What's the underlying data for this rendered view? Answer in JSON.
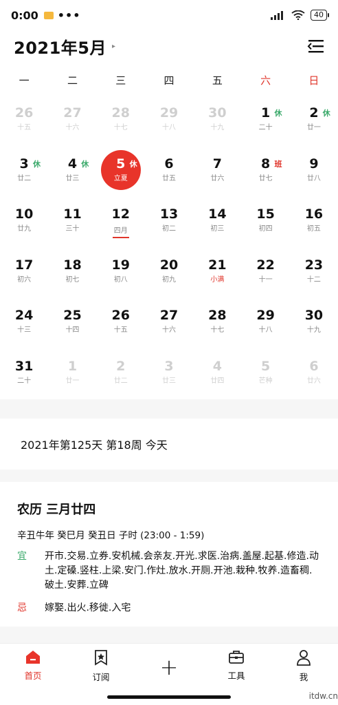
{
  "status": {
    "time": "0:00",
    "dots": "•••",
    "signal": "4G",
    "battery": "40"
  },
  "header": {
    "title": "2021年5月",
    "caret": "▸"
  },
  "weekdays": [
    "一",
    "二",
    "三",
    "四",
    "五",
    "六",
    "日"
  ],
  "days": [
    {
      "num": "26",
      "lunar": "十五",
      "faded": true
    },
    {
      "num": "27",
      "lunar": "十六",
      "faded": true
    },
    {
      "num": "28",
      "lunar": "十七",
      "faded": true
    },
    {
      "num": "29",
      "lunar": "十八",
      "faded": true
    },
    {
      "num": "30",
      "lunar": "十九",
      "faded": true
    },
    {
      "num": "1",
      "lunar": "二十",
      "tag": "休",
      "tagType": "rest"
    },
    {
      "num": "2",
      "lunar": "廿一",
      "tag": "休",
      "tagType": "rest"
    },
    {
      "num": "3",
      "lunar": "廿二",
      "tag": "休",
      "tagType": "rest"
    },
    {
      "num": "4",
      "lunar": "廿三",
      "tag": "休",
      "tagType": "rest"
    },
    {
      "num": "5",
      "lunar": "立夏",
      "tag": "休",
      "tagType": "rest",
      "today": true
    },
    {
      "num": "6",
      "lunar": "廿五"
    },
    {
      "num": "7",
      "lunar": "廿六"
    },
    {
      "num": "8",
      "lunar": "廿七",
      "tag": "班",
      "tagType": "work"
    },
    {
      "num": "9",
      "lunar": "廿八"
    },
    {
      "num": "10",
      "lunar": "廿九"
    },
    {
      "num": "11",
      "lunar": "三十"
    },
    {
      "num": "12",
      "lunar": "四月",
      "underline": true
    },
    {
      "num": "13",
      "lunar": "初二"
    },
    {
      "num": "14",
      "lunar": "初三"
    },
    {
      "num": "15",
      "lunar": "初四"
    },
    {
      "num": "16",
      "lunar": "初五"
    },
    {
      "num": "17",
      "lunar": "初六"
    },
    {
      "num": "18",
      "lunar": "初七"
    },
    {
      "num": "19",
      "lunar": "初八"
    },
    {
      "num": "20",
      "lunar": "初九"
    },
    {
      "num": "21",
      "lunar": "小满",
      "red": true
    },
    {
      "num": "22",
      "lunar": "十一"
    },
    {
      "num": "23",
      "lunar": "十二"
    },
    {
      "num": "24",
      "lunar": "十三"
    },
    {
      "num": "25",
      "lunar": "十四"
    },
    {
      "num": "26",
      "lunar": "十五"
    },
    {
      "num": "27",
      "lunar": "十六"
    },
    {
      "num": "28",
      "lunar": "十七"
    },
    {
      "num": "29",
      "lunar": "十八"
    },
    {
      "num": "30",
      "lunar": "十九"
    },
    {
      "num": "31",
      "lunar": "二十"
    },
    {
      "num": "1",
      "lunar": "廿一",
      "faded": true
    },
    {
      "num": "2",
      "lunar": "廿二",
      "faded": true
    },
    {
      "num": "3",
      "lunar": "廿三",
      "faded": true
    },
    {
      "num": "4",
      "lunar": "廿四",
      "faded": true
    },
    {
      "num": "5",
      "lunar": "芒种",
      "faded": true
    },
    {
      "num": "6",
      "lunar": "廿六",
      "faded": true
    }
  ],
  "info": {
    "text": "2021年第125天 第18周 今天"
  },
  "almanac": {
    "title": "农历 三月廿四",
    "ganzhi": "辛丑牛年 癸巳月 癸丑日 子时 (23:00 - 1:59)",
    "yi_label": "宜",
    "yi_text": "开市.交易.立券.安机械.会亲友.开光.求医.治病.盖屋.起基.修造.动土.定磉.竖柱.上梁.安门.作灶.放水.开厕.开池.栽种.牧养.造畜稠.破土.安葬.立碑",
    "ji_label": "忌",
    "ji_text": "嫁娶.出火.移徙.入宅"
  },
  "tabs": {
    "home": "首页",
    "subscribe": "订阅",
    "add": "+",
    "tools": "工具",
    "me": "我"
  },
  "colors": {
    "accent": "#e8342a",
    "rest": "#3aa96a"
  },
  "watermark": "itdw.cn"
}
